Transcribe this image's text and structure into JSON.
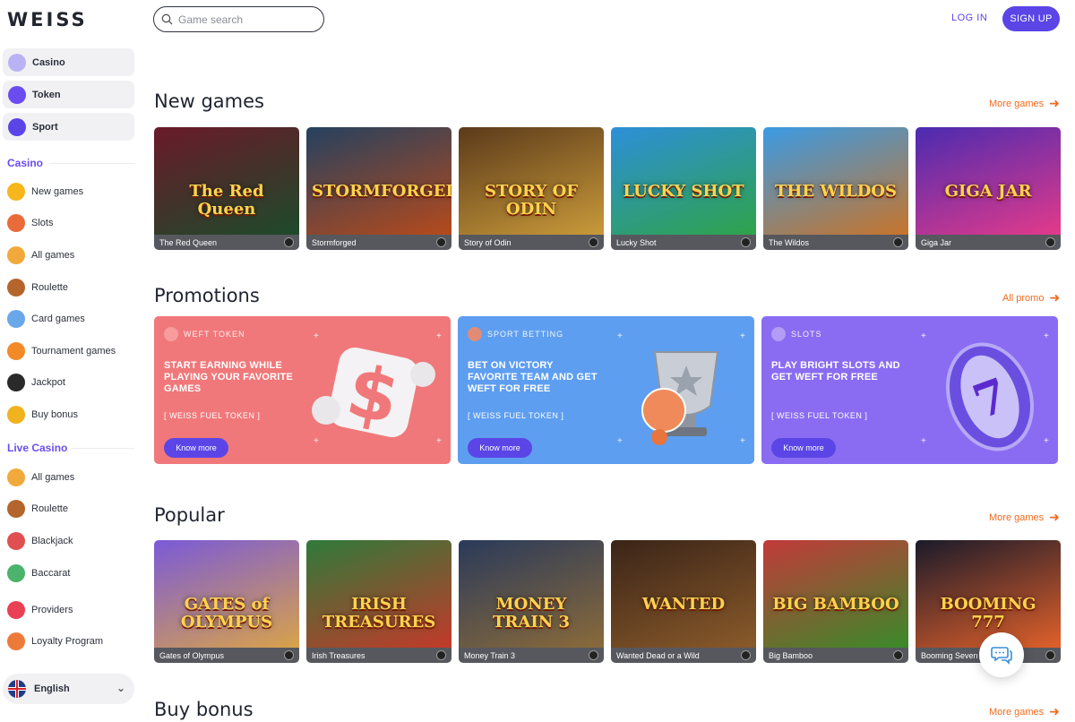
{
  "logo": "WEISS",
  "search": {
    "placeholder": "Game search"
  },
  "header": {
    "login": "LOG IN",
    "signup": "SIGN UP"
  },
  "sidebar": {
    "main": [
      {
        "label": "Casino",
        "icon": "cherry-icon",
        "color": "#b9b3f5"
      },
      {
        "label": "Token",
        "icon": "token-icon",
        "color": "#6b4cf0"
      },
      {
        "label": "Sport",
        "icon": "basketball-icon",
        "color": "#5b45e6"
      }
    ],
    "casino_title": "Casino",
    "casino_items": [
      {
        "label": "New games",
        "icon": "new-badge-icon",
        "color": "#f6b61c"
      },
      {
        "label": "Slots",
        "icon": "slot-machine-icon",
        "color": "#e96b3a"
      },
      {
        "label": "All games",
        "icon": "dice-icon",
        "color": "#f2a93b"
      },
      {
        "label": "Roulette",
        "icon": "roulette-icon",
        "color": "#b4652b"
      },
      {
        "label": "Card games",
        "icon": "cards-icon",
        "color": "#6aa7e8"
      },
      {
        "label": "Tournament games",
        "icon": "trophy-icon",
        "color": "#f28a28"
      },
      {
        "label": "Jackpot",
        "icon": "bomb-icon",
        "color": "#2a2a2a"
      },
      {
        "label": "Buy bonus",
        "icon": "coins-icon",
        "color": "#f0b21d"
      }
    ],
    "live_title": "Live Casino",
    "live_items": [
      {
        "label": "All games",
        "icon": "dice-icon",
        "color": "#f2a93b"
      },
      {
        "label": "Roulette",
        "icon": "roulette-icon",
        "color": "#b4652b"
      },
      {
        "label": "Blackjack",
        "icon": "blackjack-icon",
        "color": "#e05050"
      },
      {
        "label": "Baccarat",
        "icon": "baccarat-icon",
        "color": "#4bb36b"
      }
    ],
    "extra_items": [
      {
        "label": "Providers",
        "icon": "providers-icon",
        "color": "#e94055"
      },
      {
        "label": "Loyalty Program",
        "icon": "loyalty-icon",
        "color": "#ee7a3a"
      }
    ],
    "language": "English"
  },
  "sections": {
    "new_games": {
      "title": "New games",
      "more": "More games"
    },
    "promotions": {
      "title": "Promotions",
      "more": "All promo"
    },
    "popular": {
      "title": "Popular",
      "more": "More games"
    },
    "buy_bonus": {
      "title": "Buy bonus",
      "more": "More games"
    }
  },
  "new_games": [
    {
      "name": "The Red Queen",
      "art": "The Red Queen",
      "bg1": "#6a1a2a",
      "bg2": "#1d4a2a"
    },
    {
      "name": "Stormforged",
      "art": "STORMFORGED",
      "bg1": "#25415f",
      "bg2": "#b54a1c"
    },
    {
      "name": "Story of Odin",
      "art": "STORY OF ODIN",
      "bg1": "#5b3a1a",
      "bg2": "#c99a3a"
    },
    {
      "name": "Lucky Shot",
      "art": "LUCKY SHOT",
      "bg1": "#2d8fd9",
      "bg2": "#2fa34a"
    },
    {
      "name": "The Wildos",
      "art": "THE WILDOS",
      "bg1": "#3a9be5",
      "bg2": "#c8742a"
    },
    {
      "name": "Giga Jar",
      "art": "GIGA JAR",
      "bg1": "#4a2bb0",
      "bg2": "#e33a8a"
    }
  ],
  "promotions": [
    {
      "tag": "WEFT TOKEN",
      "headline": "START EARNING WHILE PLAYING YOUR FAVORITE GAMES",
      "sub": "[ WEISS FUEL TOKEN ]",
      "button": "Know more",
      "bg": "#f0787a",
      "dot": "#f7a0a0",
      "art": "dollar-token-icon"
    },
    {
      "tag": "SPORT BETTING",
      "headline": "BET ON VICTORY FAVORITE TEAM AND GET WEFT FOR FREE",
      "sub": "[ WEISS FUEL TOKEN ]",
      "button": "Know more",
      "bg": "#5e9ef0",
      "dot": "#f08a6a",
      "art": "trophy-ball-icon"
    },
    {
      "tag": "SLOTS",
      "headline": "PLAY BRIGHT SLOTS AND GET WEFT FOR FREE",
      "sub": "[ WEISS FUEL TOKEN ]",
      "button": "Know more",
      "bg": "#8a6cf2",
      "dot": "#b7a2f7",
      "art": "slot-reel-icon"
    }
  ],
  "popular": [
    {
      "name": "Gates of Olympus",
      "art": "GATES of OLYMPUS",
      "bg1": "#7a5ad8",
      "bg2": "#d9a24a"
    },
    {
      "name": "Irish Treasures",
      "art": "IRISH TREASURES",
      "bg1": "#2f7a3a",
      "bg2": "#c23a2a"
    },
    {
      "name": "Money Train 3",
      "art": "MONEY TRAIN 3",
      "bg1": "#2a3a5a",
      "bg2": "#8a6a3a"
    },
    {
      "name": "Wanted Dead or a Wild",
      "art": "WANTED",
      "bg1": "#3a2418",
      "bg2": "#8a5a2a"
    },
    {
      "name": "Big Bamboo",
      "art": "BIG BAMBOO",
      "bg1": "#c23a3a",
      "bg2": "#3a8a2a"
    },
    {
      "name": "Booming Seven",
      "art": "BOOMING 777",
      "bg1": "#1a1a2a",
      "bg2": "#e0602a"
    }
  ]
}
